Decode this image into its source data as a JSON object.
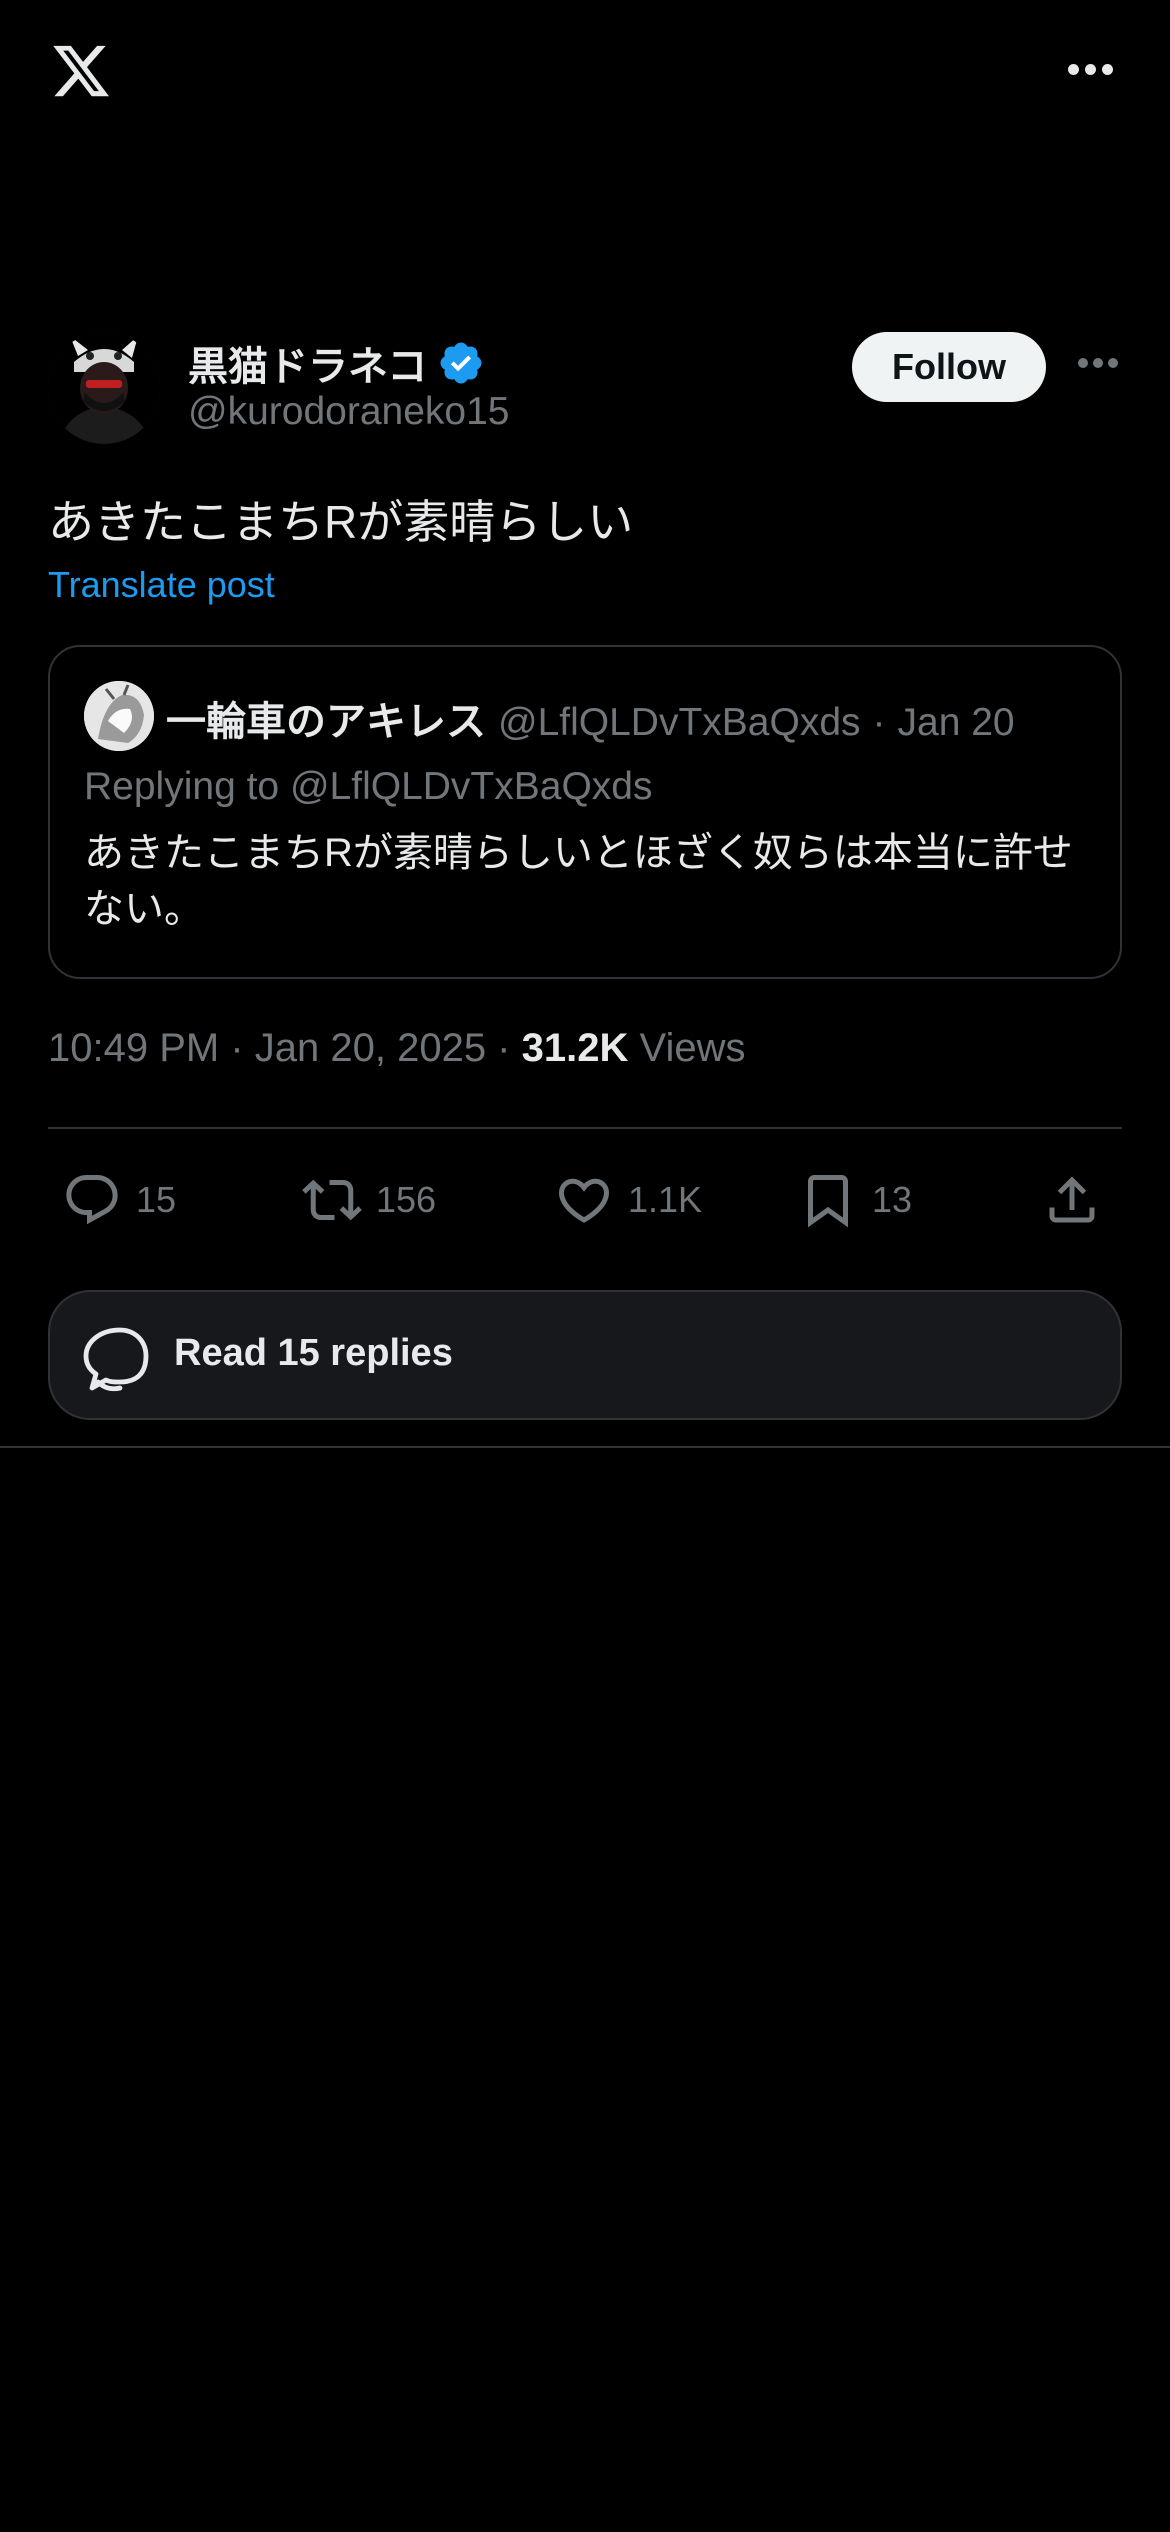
{
  "header": {
    "logo_icon": "x-logo-icon",
    "more_icon": "more-horizontal-icon"
  },
  "author": {
    "display_name": "黒猫ドラネコ",
    "handle": "@kurodoraneko15",
    "verified_icon": "verified-badge-icon",
    "follow_label": "Follow",
    "more_icon": "more-horizontal-icon"
  },
  "post": {
    "text": "あきたこまちRが素晴らしい",
    "translate_label": "Translate post"
  },
  "quote": {
    "name": "一輪車のアキレス",
    "handle": "@LflQLDvTxBaQxds",
    "separator": "·",
    "date": "Jan 20",
    "replying_to": "Replying to @LflQLDvTxBaQxds",
    "text": "あきたこまちRが素晴らしいとほざく奴らは本当に許せない。"
  },
  "meta": {
    "time": "10:49 PM · Jan 20, 2025 ·",
    "views_count": "31.2K",
    "views_label": "Views"
  },
  "actions": {
    "replies": "15",
    "reposts": "156",
    "likes": "1.1K",
    "bookmarks": "13"
  },
  "read_replies": {
    "label": "Read 15 replies",
    "icon": "conversation-icon"
  },
  "colors": {
    "accent": "#1d9bf0",
    "background": "#000000",
    "muted": "#71767b",
    "border": "#2f3336"
  }
}
